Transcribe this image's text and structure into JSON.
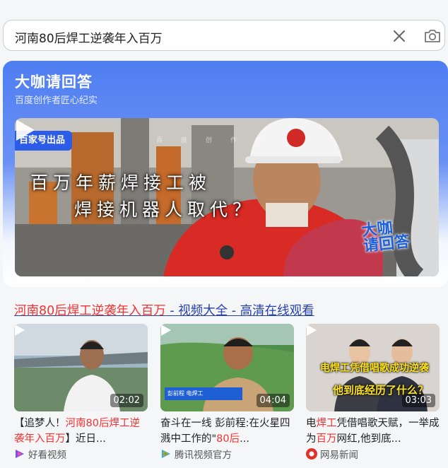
{
  "search": {
    "query": "河南80后焊工逆袭年入百万",
    "clear_icon": "close-icon",
    "camera_icon": "camera-icon"
  },
  "answer_card": {
    "title": "大咖请回答",
    "subtitle": "百度创作者匠心纪实",
    "badge": "百家号出品",
    "watermark": "百度创作者",
    "hero_line1": "百万年薪焊接工被",
    "hero_line2": "焊接机器人取代？",
    "hero_logo_1": "大咖",
    "hero_logo_2": "请回答",
    "accent_color": "#4f7ef2"
  },
  "result": {
    "title_em": "河南80后焊工逆袭年入百万",
    "title_rest": " - 视频大全 - 高清在线观看",
    "videos": [
      {
        "duration": "02:02",
        "desc_pre": "【追梦人！",
        "desc_em": "河南80后焊工逆袭年入百万",
        "desc_post": "】近日...",
        "source": "好看视频",
        "source_icon": "haokan-icon"
      },
      {
        "duration": "04:04",
        "desc_pre": "奋斗在一线 彭前程:在火星四溅中工作的\"",
        "desc_em": "80后",
        "desc_post": "...",
        "source": "腾讯视频官方",
        "source_icon": "tencent-video-icon",
        "strip_text": "彭前程 电焊工"
      },
      {
        "duration": "03:03",
        "desc_pre": "电",
        "desc_em": "焊工",
        "desc_mid": "凭借唱歌天赋，一举成为",
        "desc_em2": "百万",
        "desc_post": "网红,他到底...",
        "source": "网易新闻",
        "source_icon": "netease-icon",
        "caption1": "电焊工凭借唱歌成功逆袭",
        "caption2": "他到底经历了什么？"
      }
    ]
  }
}
